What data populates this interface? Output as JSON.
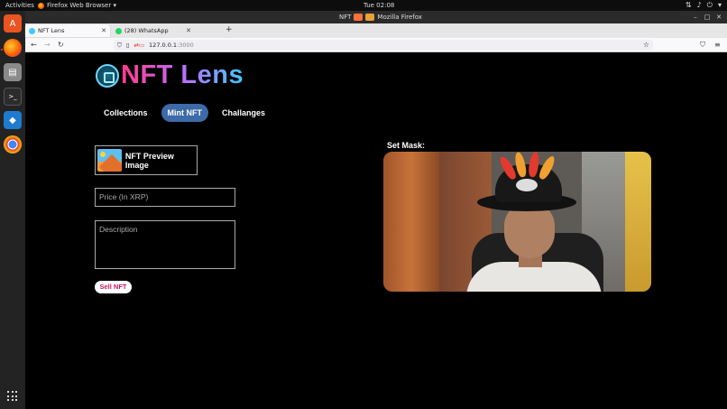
{
  "desktop": {
    "activities_label": "Activities",
    "app_menu_label": "Firefox Web Browser ▾",
    "clock": "Tue 02:08",
    "tray_icons": [
      "network-icon",
      "volume-icon",
      "power-icon",
      "chevron-down-icon"
    ]
  },
  "dock": {
    "apps": [
      {
        "name": "ubuntu-software-icon",
        "color": "#e95420",
        "glyph": "A"
      },
      {
        "name": "firefox-icon",
        "color": "#ff7139",
        "glyph": ""
      },
      {
        "name": "files-icon",
        "color": "#8a8a8a",
        "glyph": "▤"
      },
      {
        "name": "terminal-icon",
        "color": "#2c2c2c",
        "glyph": ">_"
      },
      {
        "name": "vscode-icon",
        "color": "#1e7bd0",
        "glyph": "◆"
      },
      {
        "name": "chrome-icon",
        "color": "#e53935",
        "glyph": "◉"
      }
    ],
    "show_apps_icon": "grid-icon"
  },
  "window": {
    "title_prefix": "NFT",
    "title_suffix": "Mozilla Firefox"
  },
  "tabs": [
    {
      "label": "NFT Lens",
      "favicon_color": "#3fc9ff",
      "active": true
    },
    {
      "label": "(28) WhatsApp",
      "favicon_color": "#25d366",
      "active": false
    }
  ],
  "navbar": {
    "url_host": "127.0.0.1",
    "url_port": ":3000"
  },
  "page": {
    "logo_text": "NFT Lens",
    "nav": [
      {
        "label": "Collections",
        "active": false
      },
      {
        "label": "Mint NFT",
        "active": true
      },
      {
        "label": "Challanges",
        "active": false
      }
    ],
    "preview_label": "NFT Preview Image",
    "price_placeholder": "Price (In XRP)",
    "description_placeholder": "Description",
    "sell_label": "Sell NFT",
    "mask_label": "Set Mask:"
  }
}
